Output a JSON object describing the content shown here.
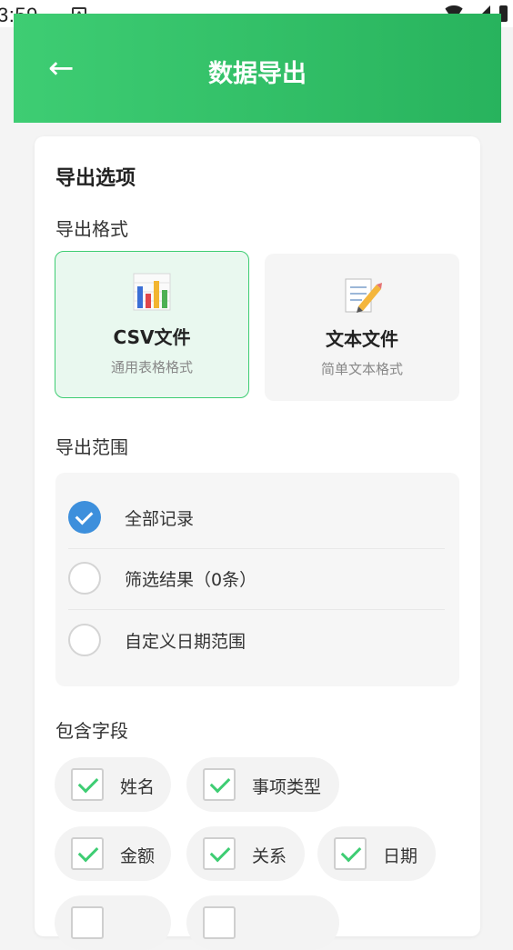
{
  "status": {
    "time": "3:59",
    "notif_glyph": "A"
  },
  "header": {
    "title": "数据导出",
    "back_icon": "←"
  },
  "card": {
    "title": "导出选项",
    "format_label": "导出格式",
    "formats": [
      {
        "title": "CSV文件",
        "subtitle": "通用表格格式",
        "selected": true,
        "icon": "bar-chart-icon"
      },
      {
        "title": "文本文件",
        "subtitle": "简单文本格式",
        "selected": false,
        "icon": "memo-icon"
      }
    ],
    "range_label": "导出范围",
    "ranges": [
      {
        "label": "全部记录",
        "checked": true
      },
      {
        "label": "筛选结果（0条）",
        "checked": false
      },
      {
        "label": "自定义日期范围",
        "checked": false
      }
    ],
    "fields_label": "包含字段",
    "fields": [
      {
        "label": "姓名",
        "checked": true
      },
      {
        "label": "事项类型",
        "checked": true
      },
      {
        "label": "金额",
        "checked": true
      },
      {
        "label": "关系",
        "checked": true
      },
      {
        "label": "日期",
        "checked": true
      },
      {
        "label": "",
        "checked": false
      },
      {
        "label": "",
        "checked": false
      }
    ]
  },
  "colors": {
    "primary": "#3ecd73",
    "radio_selected": "#3d8fdc",
    "selected_bg": "#e9f8ef"
  }
}
